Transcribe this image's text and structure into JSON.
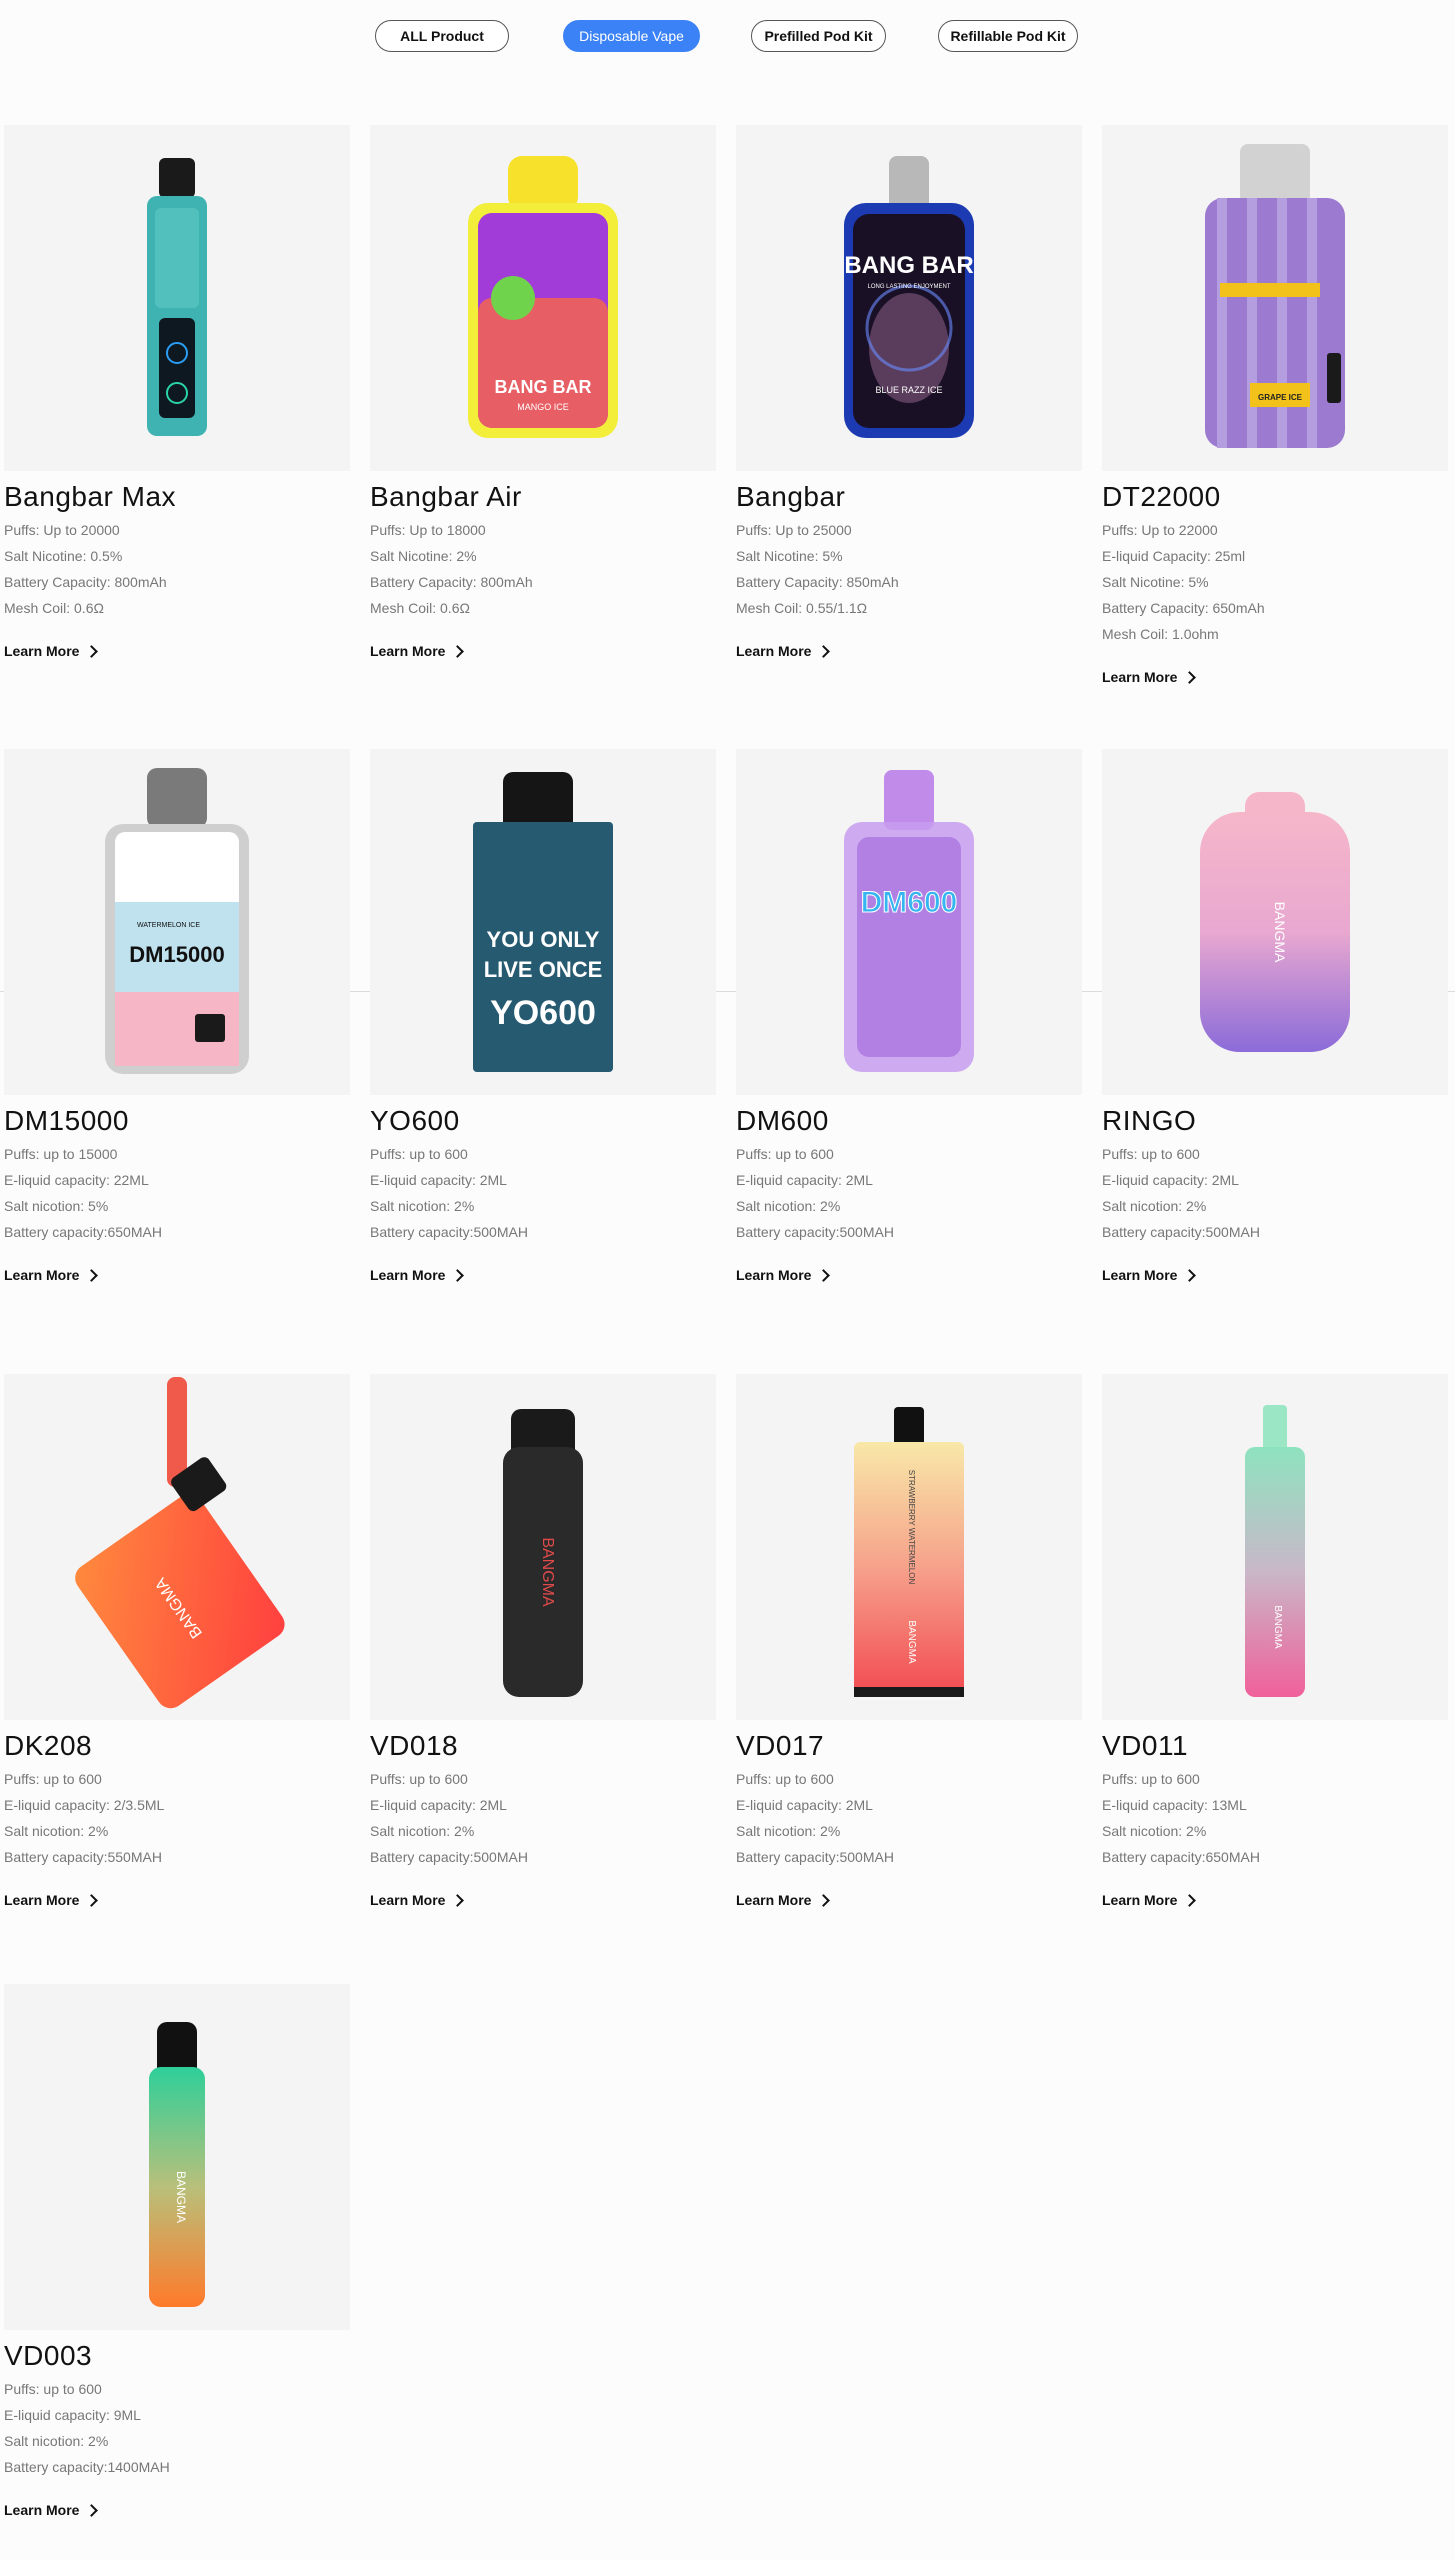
{
  "filters": [
    "ALL Product",
    "Disposable Vape",
    "Prefilled Pod Kit",
    "Refillable Pod Kit"
  ],
  "active_filter": "Disposable Vape",
  "learn_more": "Learn More",
  "products": [
    {
      "name": "Bangbar Max",
      "specs": [
        "Puffs: Up to 20000",
        "Salt Nicotine: 0.5%",
        "Battery Capacity: 800mAh",
        "Mesh Coil: 0.6Ω"
      ],
      "icon": "vape-device-icon"
    },
    {
      "name": "Bangbar Air",
      "specs": [
        "Puffs: Up to 18000",
        "Salt Nicotine: 2%",
        "Battery Capacity: 800mAh",
        "Mesh Coil: 0.6Ω"
      ],
      "icon": "vape-device-icon"
    },
    {
      "name": "Bangbar",
      "specs": [
        "Puffs: Up to 25000",
        "Salt Nicotine: 5%",
        "Battery Capacity: 850mAh",
        "Mesh Coil: 0.55/1.1Ω"
      ],
      "icon": "vape-device-icon"
    },
    {
      "name": "DT22000",
      "specs": [
        "Puffs: Up to 22000",
        "E-liquid Capacity: 25ml",
        "Salt Nicotine: 5%",
        "Battery Capacity: 650mAh",
        "Mesh Coil: 1.0ohm"
      ],
      "icon": "vape-device-icon"
    },
    {
      "name": "DM15000",
      "specs": [
        "Puffs: up to 15000",
        "E-liquid capacity: 22ML",
        "Salt nicotion: 5%",
        "Battery capacity:650MAH"
      ],
      "icon": "vape-device-icon"
    },
    {
      "name": "YO600",
      "specs": [
        "Puffs: up to 600",
        "E-liquid capacity: 2ML",
        "Salt nicotion: 2%",
        "Battery capacity:500MAH"
      ],
      "icon": "vape-device-icon"
    },
    {
      "name": "DM600",
      "specs": [
        "Puffs: up to 600",
        "E-liquid capacity: 2ML",
        "Salt nicotion: 2%",
        "Battery capacity:500MAH"
      ],
      "icon": "vape-device-icon"
    },
    {
      "name": "RINGO",
      "specs": [
        "Puffs: up to 600",
        "E-liquid capacity: 2ML",
        "Salt nicotion: 2%",
        "Battery capacity:500MAH"
      ],
      "icon": "vape-device-icon"
    },
    {
      "name": "DK208",
      "specs": [
        "Puffs: up to 600",
        "E-liquid capacity: 2/3.5ML",
        "Salt nicotion: 2%",
        "Battery capacity:550MAH"
      ],
      "icon": "vape-device-icon"
    },
    {
      "name": "VD018",
      "specs": [
        "Puffs: up to 600",
        "E-liquid capacity: 2ML",
        "Salt nicotion: 2%",
        "Battery capacity:500MAH"
      ],
      "icon": "vape-device-icon"
    },
    {
      "name": "VD017",
      "specs": [
        "Puffs: up to 600",
        "E-liquid capacity: 2ML",
        "Salt nicotion: 2%",
        "Battery capacity:500MAH"
      ],
      "icon": "vape-device-icon"
    },
    {
      "name": "VD011",
      "specs": [
        "Puffs: up to 600",
        "E-liquid capacity: 13ML",
        "Salt nicotion: 2%",
        "Battery capacity:650MAH"
      ],
      "icon": "vape-device-icon"
    },
    {
      "name": "VD003",
      "specs": [
        "Puffs: up to 600",
        "E-liquid capacity: 9ML",
        "Salt nicotion: 2%",
        "Battery capacity:1400MAH"
      ],
      "icon": "vape-device-icon"
    }
  ],
  "image_labels": {
    "bangbar_air_brand": "BANG BAR",
    "bangbar_air_flavor": "MANGO ICE",
    "bangbar_brand": "BANG BAR",
    "bangbar_tagline": "LONG LASTING ENJOYMENT",
    "bangbar_flavor": "BLUE RAZZ ICE",
    "dt_flavor": "GRAPE ICE",
    "dm15000_model": "DM15000",
    "dm15000_flavor": "WATERMELON ICE",
    "yo600_line1": "YOU ONLY",
    "yo600_line2": "LIVE ONCE",
    "yo600_model": "YO600",
    "dm600_model": "DM600",
    "brand": "BANGMA",
    "vd017_flavor": "STRAWBERRY WATERMELON"
  },
  "colors": {
    "active_filter_bg": "#3b82f6",
    "card_bg": "#f4f4f4"
  }
}
